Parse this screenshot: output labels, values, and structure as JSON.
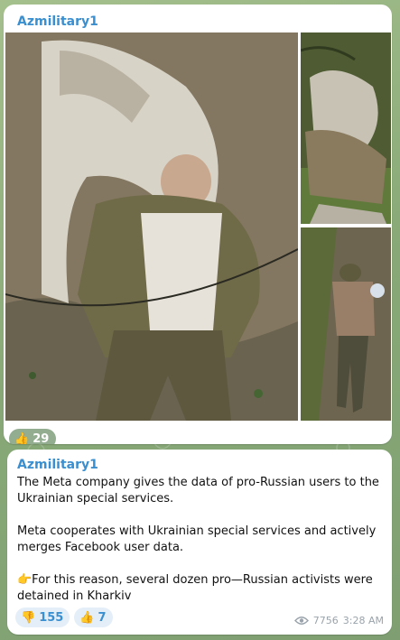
{
  "background": {
    "color": "#8fae7e"
  },
  "post_media": {
    "sender": "Azmilitary1",
    "sender_color": "#3a8fd0",
    "photos": [
      {
        "icon": "photo-main"
      },
      {
        "icon": "photo-top-right"
      },
      {
        "icon": "photo-bottom-right"
      }
    ],
    "reaction": {
      "emoji": "👍",
      "count": "29"
    }
  },
  "post_text": {
    "sender": "Azmilitary1",
    "paragraphs": [
      "The Meta company gives the data of pro-Russian users to the Ukrainian special services.",
      "Meta cooperates with Ukrainian special services and actively merges Facebook user data.",
      "👉For this reason, several dozen pro—Russian activists were detained in Kharkiv"
    ],
    "reactions": [
      {
        "emoji": "👎",
        "count": "155"
      },
      {
        "emoji": "👍",
        "count": "7"
      }
    ],
    "views": "7756",
    "time": "3:28 AM"
  }
}
